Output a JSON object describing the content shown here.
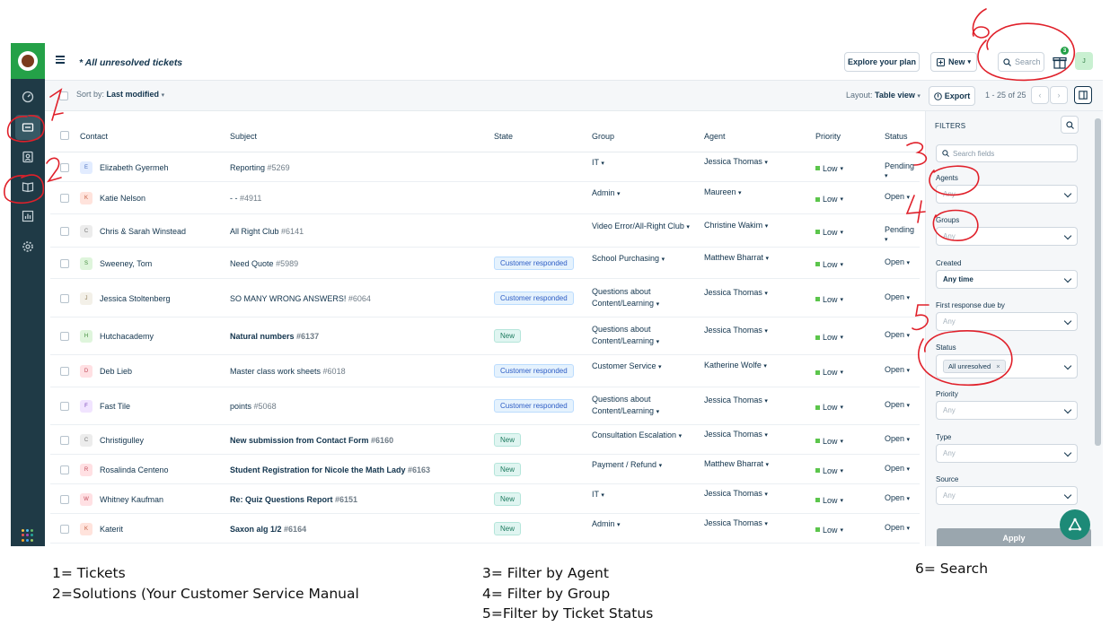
{
  "header": {
    "title": "* All unresolved tickets",
    "explore_label": "Explore your plan",
    "new_label": "New",
    "search_placeholder": "Search",
    "gift_badge": "3",
    "avatar_initial": "J"
  },
  "toolbar": {
    "sort_prefix": "Sort by:",
    "sort_value": "Last modified",
    "layout_prefix": "Layout:",
    "layout_value": "Table view",
    "export_label": "Export",
    "pager_text": "1 - 25 of 25"
  },
  "table": {
    "headers": [
      "Contact",
      "Subject",
      "State",
      "Group",
      "Agent",
      "Priority",
      "Status"
    ],
    "rows": [
      {
        "contact": "Elizabeth Gyermeh",
        "initial": "E",
        "subject": "Reporting",
        "num": "#5269",
        "bold": false,
        "state": "",
        "group": "IT",
        "agent": "Jessica Thomas",
        "priority": "Low",
        "status": "Pending"
      },
      {
        "contact": "Katie Nelson",
        "initial": "K",
        "subject": "- -",
        "num": "#4911",
        "bold": false,
        "state": "",
        "group": "Admin",
        "agent": "Maureen",
        "priority": "Low",
        "status": "Open"
      },
      {
        "contact": "Chris & Sarah Winstead",
        "initial": "C",
        "subject": "All Right Club",
        "num": "#6141",
        "bold": false,
        "state": "",
        "group": "Video Error/All-Right Club",
        "agent": "Christine Wakim",
        "priority": "Low",
        "status": "Pending"
      },
      {
        "contact": "Sweeney, Tom",
        "initial": "S",
        "subject": "Need Quote",
        "num": "#5989",
        "bold": false,
        "state": "Customer responded",
        "group": "School Purchasing",
        "agent": "Matthew Bharrat",
        "priority": "Low",
        "status": "Open"
      },
      {
        "contact": "Jessica Stoltenberg",
        "initial": "J",
        "subject": "SO MANY WRONG ANSWERS!",
        "num": "#6064",
        "bold": false,
        "state": "Customer responded",
        "group": "Questions about Content/Learning",
        "agent": "Jessica Thomas",
        "priority": "Low",
        "status": "Open"
      },
      {
        "contact": "Hutchacademy",
        "initial": "H",
        "subject": "Natural numbers",
        "num": "#6137",
        "bold": true,
        "state": "New",
        "group": "Questions about Content/Learning",
        "agent": "Jessica Thomas",
        "priority": "Low",
        "status": "Open"
      },
      {
        "contact": "Deb Lieb",
        "initial": "D",
        "subject": "Master class work sheets",
        "num": "#6018",
        "bold": false,
        "state": "Customer responded",
        "group": "Customer Service",
        "agent": "Katherine Wolfe",
        "priority": "Low",
        "status": "Open"
      },
      {
        "contact": "Fast Tile",
        "initial": "F",
        "subject": "points",
        "num": "#5068",
        "bold": false,
        "state": "Customer responded",
        "group": "Questions about Content/Learning",
        "agent": "Jessica Thomas",
        "priority": "Low",
        "status": "Open"
      },
      {
        "contact": "Christigulley",
        "initial": "C",
        "subject": "New submission from Contact Form",
        "num": "#6160",
        "bold": true,
        "state": "New",
        "group": "Consultation Escalation",
        "agent": "Jessica Thomas",
        "priority": "Low",
        "status": "Open"
      },
      {
        "contact": "Rosalinda Centeno",
        "initial": "R",
        "subject": "Student Registration for Nicole the Math Lady",
        "num": "#6163",
        "bold": true,
        "state": "New",
        "group": "Payment / Refund",
        "agent": "Matthew Bharrat",
        "priority": "Low",
        "status": "Open"
      },
      {
        "contact": "Whitney Kaufman",
        "initial": "W",
        "subject": "Re: Quiz Questions Report",
        "num": "#6151",
        "bold": true,
        "state": "New",
        "group": "IT",
        "agent": "Jessica Thomas",
        "priority": "Low",
        "status": "Open"
      },
      {
        "contact": "Katerit",
        "initial": "K",
        "subject": "Saxon alg 1/2",
        "num": "#6164",
        "bold": true,
        "state": "New",
        "group": "Admin",
        "agent": "Jessica Thomas",
        "priority": "Low",
        "status": "Open"
      }
    ]
  },
  "filters": {
    "title": "FILTERS",
    "search_placeholder": "Search fields",
    "agents_label": "Agents",
    "agents_value": "Any",
    "groups_label": "Groups",
    "groups_value": "Any",
    "created_label": "Created",
    "created_value": "Any time",
    "first_response_label": "First response due by",
    "first_response_value": "Any",
    "status_label": "Status",
    "status_chip": "All unresolved",
    "priority_label": "Priority",
    "priority_value": "Any",
    "type_label": "Type",
    "type_value": "Any",
    "source_label": "Source",
    "source_value": "Any",
    "apply_label": "Apply"
  },
  "annotations": {
    "legend_1": "1= Tickets",
    "legend_2": "2=Solutions (Your Customer Service Manual",
    "legend_3": "3= Filter by Agent",
    "legend_4": "4= Filter by Group",
    "legend_5": "5=Filter by Ticket Status",
    "legend_6": "6= Search",
    "mark_1": "1",
    "mark_2": "2",
    "mark_3": "3",
    "mark_4": "4",
    "mark_5": "5",
    "mark_6": "6"
  },
  "colors": {
    "nav_bg": "#1f3a46",
    "brand_green": "#24a148",
    "annotation_red": "#e0202a",
    "priority_low": "#5cc54c"
  },
  "icons": {
    "nav": [
      "dashboard-icon",
      "tickets-icon",
      "contacts-icon",
      "solutions-icon",
      "reports-icon",
      "settings-icon"
    ],
    "top": [
      "menu-icon",
      "plus-box-icon",
      "search-icon",
      "gift-icon"
    ]
  }
}
